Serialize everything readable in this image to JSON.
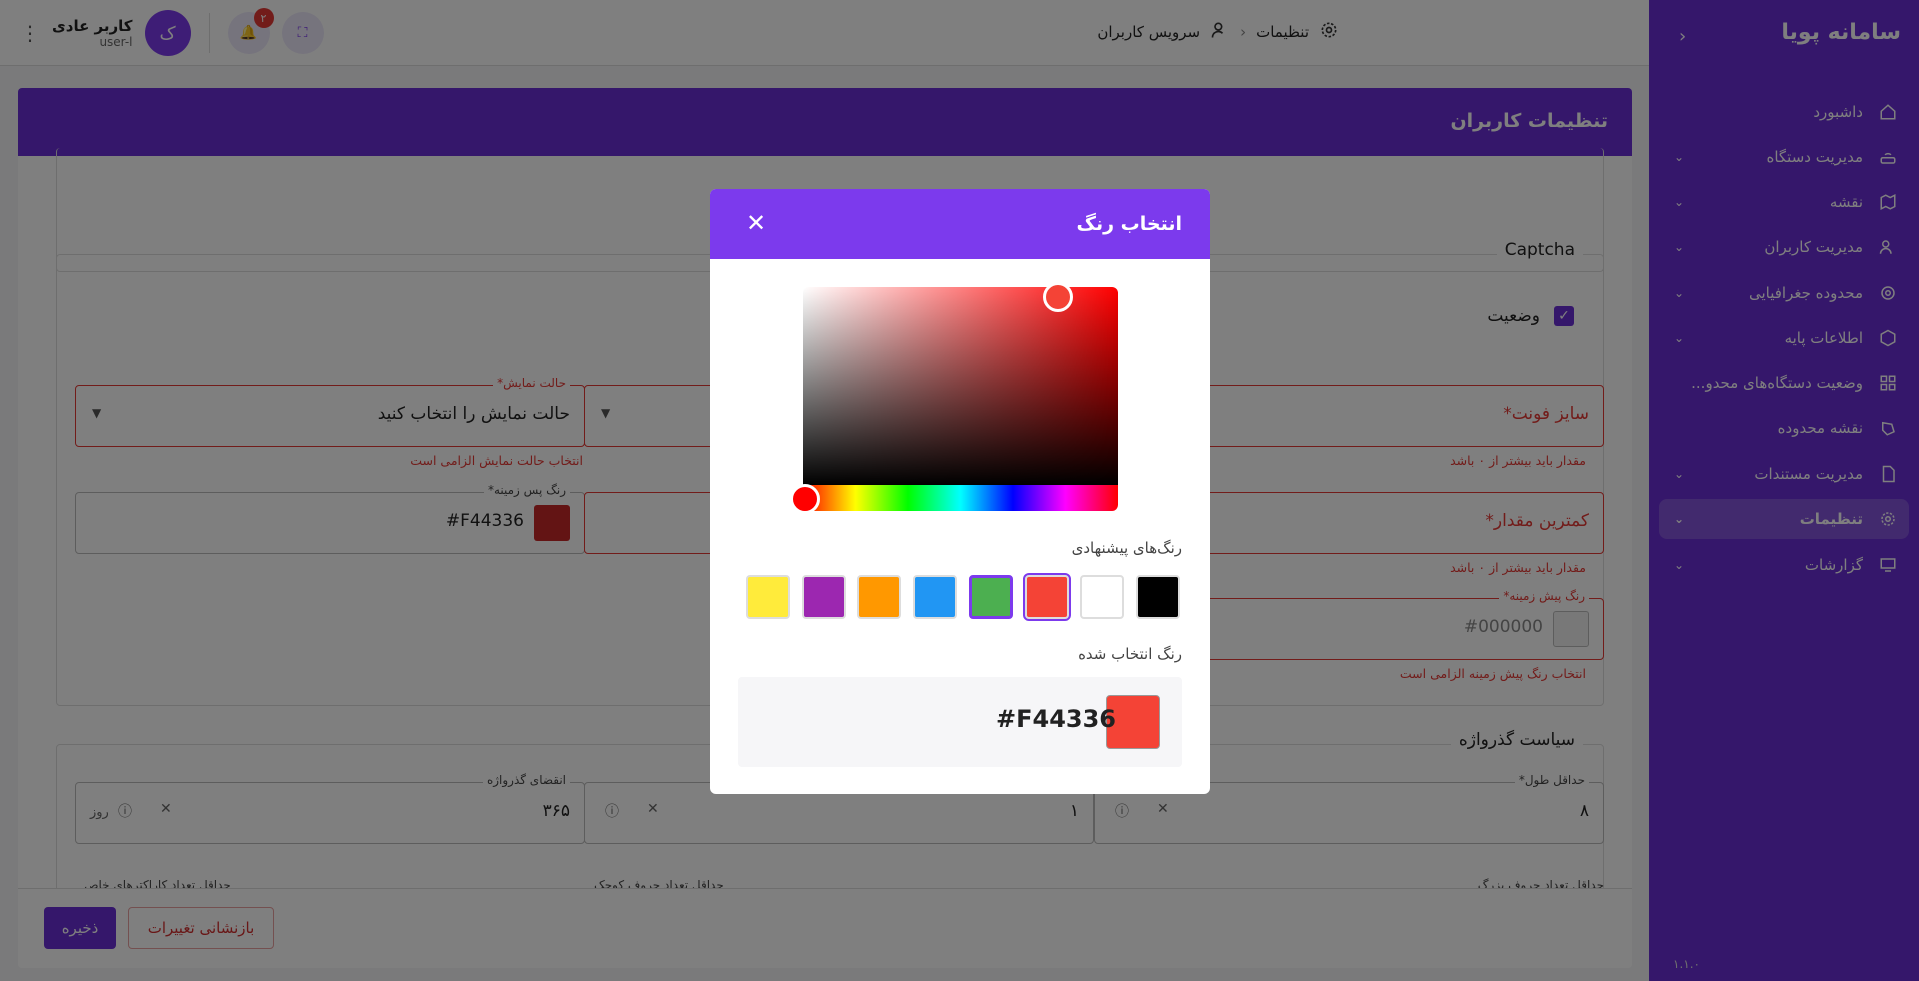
{
  "sidebar": {
    "brand": "سامانه پویا",
    "version": "۱.۱.۰",
    "items": [
      {
        "label": "داشبورد"
      },
      {
        "label": "مدیریت دستگاه"
      },
      {
        "label": "نقشه"
      },
      {
        "label": "مدیریت کاربران"
      },
      {
        "label": "محدوده جغرافیایی"
      },
      {
        "label": "اطلاعات پایه"
      },
      {
        "label": "وضعیت دستگاه‌های محدو..."
      },
      {
        "label": "نقشه محدوده"
      },
      {
        "label": "مدیریت مستندات"
      },
      {
        "label": "تنظیمات"
      },
      {
        "label": "گزارشات"
      }
    ]
  },
  "topbar": {
    "breadcrumb_root": "تنظیمات",
    "breadcrumb_current": "سرویس کاربران",
    "user_name": "کاربر عادی",
    "user_role": "user-l",
    "avatar_letter": "ک",
    "notification_count": "۲"
  },
  "page": {
    "title": "تنظیمات کاربران",
    "captcha": {
      "title": "Captcha",
      "status_label": "وضعیت",
      "display_mode_label": "حالت نمایش*",
      "display_mode_placeholder": "حالت نمایش را انتخاب کنید",
      "display_mode_error": "انتخاب حالت نمایش الزامی است",
      "font_size_placeholder": "سایز فونت*",
      "font_size_error": "مقدار باید بیشتر از ۰ باشد",
      "bg_color_label": "رنگ پس زمینه*",
      "bg_color_value": "#F44336",
      "min_value_placeholder": "کمترین مقدار*",
      "min_value_error": "مقدار باید بیشتر از ۰ باشد",
      "fg_color_label": "رنگ پیش زمینه*",
      "fg_color_value": "#000000",
      "fg_color_error": "انتخاب رنگ پیش زمینه الزامی است"
    },
    "password_policy": {
      "title": "سیاست گذرواژه",
      "expiry_label": "انقضای گذرواژه",
      "expiry_value": "۳۶۵",
      "expiry_unit": "روز",
      "mid_value": "۱",
      "min_length_label": "حداقل طول*",
      "min_length_value": "۸",
      "special_chars_label": "حداقل تعداد کاراکترهای خاص",
      "lowercase_label": "حداقل تعداد حروف کوچک",
      "uppercase_label": "حداقل تعداد حروف بزرگ"
    },
    "save_label": "ذخیره",
    "reset_label": "بازنشانی تغییرات"
  },
  "modal": {
    "title": "انتخاب رنگ",
    "suggested_label": "رنگ‌های پیشنهادی",
    "selected_label": "رنگ انتخاب شده",
    "selected_hex": "#F44336",
    "selected_color": "#f44336",
    "palette": [
      "#ffeb3b",
      "#9c27b0",
      "#ff9800",
      "#2196f3",
      "#4caf50",
      "#f44336",
      "#ffffff",
      "#000000"
    ]
  }
}
